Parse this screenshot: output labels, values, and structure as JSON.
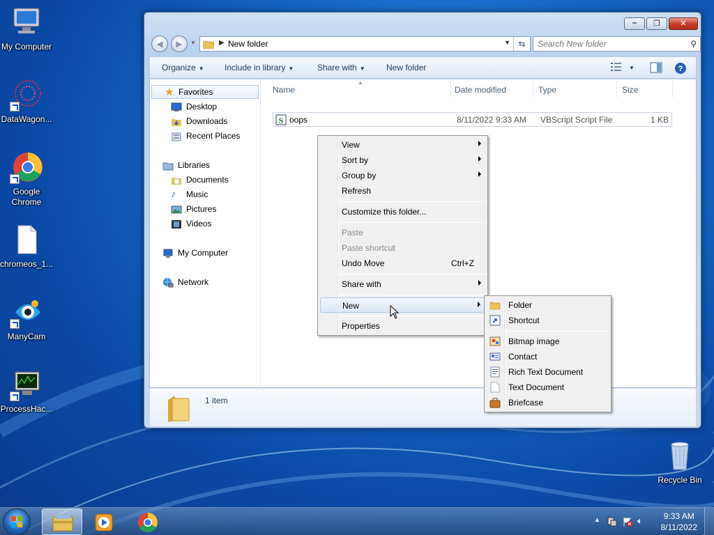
{
  "desktop": {
    "icons": [
      {
        "label": "My Computer"
      },
      {
        "label": "DataWagon..."
      },
      {
        "label": "Google Chrome"
      },
      {
        "label": "chromeos_1..."
      },
      {
        "label": "ManyCam"
      },
      {
        "label": "ProcessHac..."
      },
      {
        "label": "Recycle Bin"
      }
    ]
  },
  "window": {
    "address": {
      "folder_name": "New folder"
    },
    "search": {
      "placeholder": "Search New folder"
    },
    "toolbar": {
      "organize": "Organize",
      "include_in_library": "Include in library",
      "share_with": "Share with",
      "new_folder": "New folder"
    },
    "nav": {
      "favorites": "Favorites",
      "desktop": "Desktop",
      "downloads": "Downloads",
      "recent_places": "Recent Places",
      "libraries": "Libraries",
      "documents": "Documents",
      "music": "Music",
      "pictures": "Pictures",
      "videos": "Videos",
      "my_computer": "My Computer",
      "network": "Network"
    },
    "columns": {
      "name": "Name",
      "date_modified": "Date modified",
      "type": "Type",
      "size": "Size"
    },
    "files": [
      {
        "name": "oops",
        "date_modified": "8/11/2022 9:33 AM",
        "type": "VBScript Script File",
        "size": "1 KB"
      }
    ],
    "details": {
      "count": "1 item"
    }
  },
  "context_menu": {
    "view": "View",
    "sort_by": "Sort by",
    "group_by": "Group by",
    "refresh": "Refresh",
    "customize": "Customize this folder...",
    "paste": "Paste",
    "paste_shortcut": "Paste shortcut",
    "undo_move": "Undo Move",
    "undo_shortcut": "Ctrl+Z",
    "share_with": "Share with",
    "new": "New",
    "properties": "Properties"
  },
  "new_submenu": {
    "folder": "Folder",
    "shortcut": "Shortcut",
    "bitmap": "Bitmap image",
    "contact": "Contact",
    "rtf": "Rich Text Document",
    "txt": "Text Document",
    "briefcase": "Briefcase"
  },
  "taskbar": {
    "time": "9:33 AM",
    "date": "8/11/2022"
  }
}
